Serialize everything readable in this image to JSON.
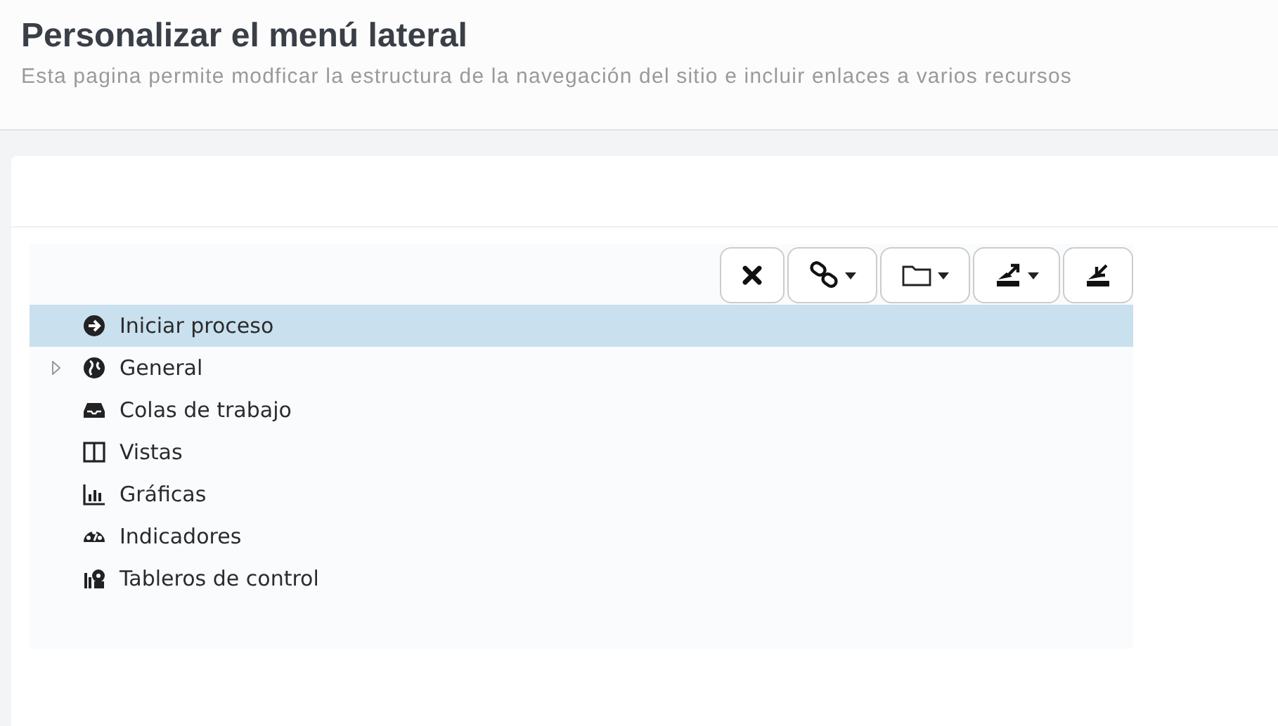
{
  "header": {
    "title": "Personalizar el menú lateral",
    "subtitle": "Esta pagina permite modficar la estructura de la navegación del sitio e incluir enlaces a varios recursos"
  },
  "toolbar": [
    {
      "kind": "delete",
      "dropdown": false
    },
    {
      "kind": "link",
      "dropdown": true
    },
    {
      "kind": "folder",
      "dropdown": true
    },
    {
      "kind": "export",
      "dropdown": true
    },
    {
      "kind": "import",
      "dropdown": false
    }
  ],
  "tree": [
    {
      "label": "Iniciar proceso",
      "kind": "arrow",
      "selected": true,
      "expandable": false
    },
    {
      "label": "General",
      "kind": "globe",
      "selected": false,
      "expandable": true
    },
    {
      "label": "Colas de trabajo",
      "kind": "inbox",
      "selected": false,
      "expandable": false
    },
    {
      "label": "Vistas",
      "kind": "columns",
      "selected": false,
      "expandable": false
    },
    {
      "label": "Gráficas",
      "kind": "chart",
      "selected": false,
      "expandable": false
    },
    {
      "label": "Indicadores",
      "kind": "gauge",
      "selected": false,
      "expandable": false
    },
    {
      "label": "Tableros de control",
      "kind": "dashboard",
      "selected": false,
      "expandable": false
    }
  ]
}
